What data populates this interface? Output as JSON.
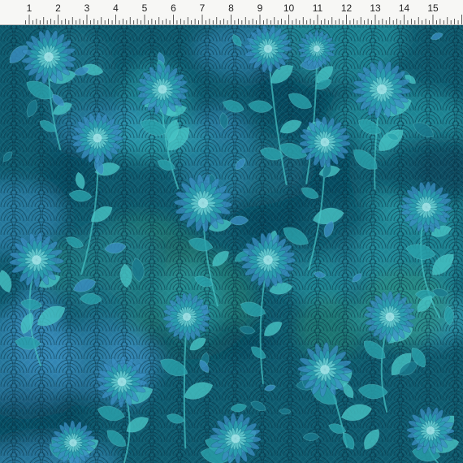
{
  "ruler": {
    "unit": "inch",
    "numbers": [
      "1",
      "2",
      "3",
      "4",
      "5",
      "6",
      "7",
      "8",
      "9",
      "10",
      "11",
      "12",
      "13",
      "14",
      "15"
    ]
  },
  "fabric": {
    "pattern": "chrysanthemum floral over seigaiha wave scales",
    "colors": {
      "base": "#0e5a6e",
      "deep": "#0a3f57",
      "mid": "#1b7a8f",
      "teal": "#2aa3ad",
      "aqua": "#46c3c4",
      "light": "#6fd3d6",
      "blue": "#3b8fc2",
      "green": "#2c8a74"
    }
  }
}
